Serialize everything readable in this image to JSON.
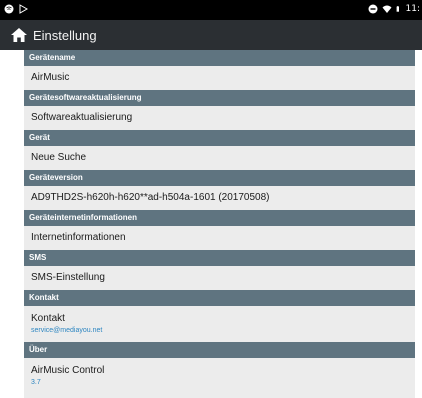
{
  "status_bar": {
    "time": "11:"
  },
  "app_bar": {
    "title": "Einstellung"
  },
  "sections": [
    {
      "header": "Gerätename",
      "item": "AirMusic"
    },
    {
      "header": "Gerätesoftwareaktualisierung",
      "item": "Softwareaktualisierung"
    },
    {
      "header": "Gerät",
      "item": "Neue Suche"
    },
    {
      "header": "Geräteversion",
      "item": "AD9THD2S-h620h-h620**ad-h504a-1601 (20170508)"
    },
    {
      "header": "Geräteinternetinformationen",
      "item": "Internetinformationen"
    },
    {
      "header": "SMS",
      "item": "SMS-Einstellung"
    },
    {
      "header": "Kontakt",
      "item": "Kontakt",
      "sub": "service@mediayou.net"
    },
    {
      "header": "Über",
      "item": "AirMusic Control",
      "sub": "3.7"
    }
  ]
}
